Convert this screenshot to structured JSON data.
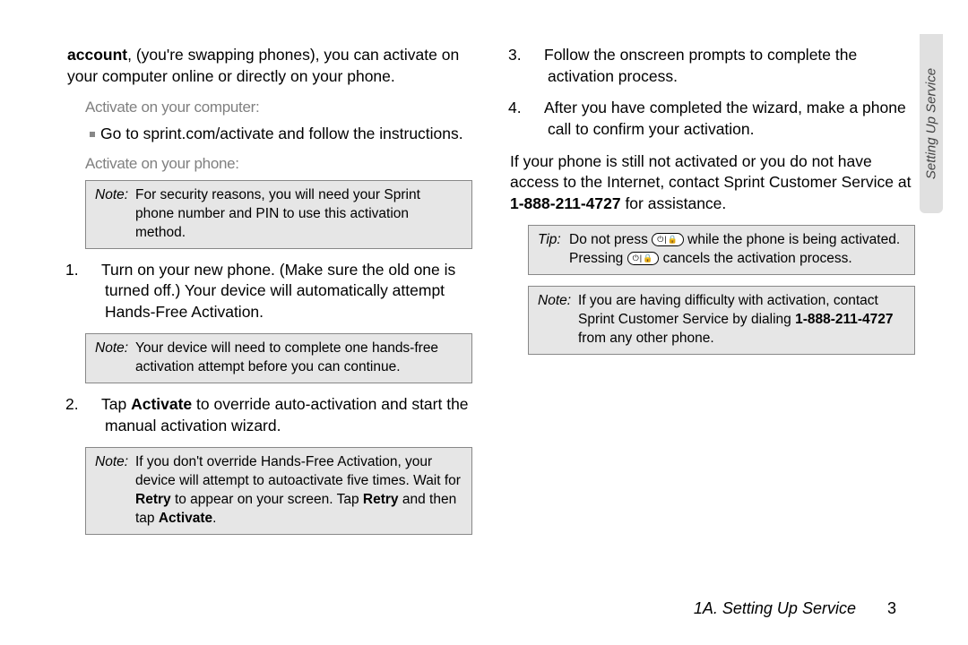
{
  "col1": {
    "intro_lead_bold": "account",
    "intro_rest": ", (you're swapping phones), you can activate on your computer online or directly on your phone.",
    "subhead1": "Activate on your computer:",
    "bullet1": "Go to sprint.com/activate and follow the instructions.",
    "subhead2": "Activate on your phone:",
    "note1_label": "Note:",
    "note1_body": "For security reasons, you will need your Sprint phone number and PIN to use this activation method.",
    "step1_num": "1.",
    "step1": "Turn on your new phone. (Make sure the old one is turned off.) Your device will automatically attempt Hands-Free Activation.",
    "note2_label": "Note:",
    "note2_body": "Your device will need to complete one hands-free activation attempt before you can continue.",
    "step2_num": "2.",
    "step2_a": "Tap ",
    "step2_b_bold": "Activate",
    "step2_c": " to override auto-activation and start the manual activation wizard.",
    "note3_label": "Note:",
    "note3_a": "If you don't override Hands-Free Activation, your device will attempt to autoactivate five times. Wait for ",
    "note3_b_bold": "Retry",
    "note3_c": " to appear on your screen. Tap ",
    "note3_d_bold": "Retry",
    "note3_e": " and then tap ",
    "note3_f_bold": "Activate",
    "note3_g": "."
  },
  "col2": {
    "step3_num": "3.",
    "step3": "Follow the onscreen prompts to complete the activation process.",
    "step4_num": "4.",
    "step4": "After you have completed the wizard, make a phone call to confirm your activation.",
    "para_a": "If your phone is still not activated or you do not have access to the Internet, contact Sprint Customer Service at ",
    "para_b_bold": "1-888-211-4727",
    "para_c": " for assistance.",
    "tip_label": "Tip:",
    "tip_a": "Do not press ",
    "tip_b": " while the phone is being activated. Pressing ",
    "tip_c": " cancels the activation process.",
    "note4_label": "Note:",
    "note4_a": "If you are having difficulty with activation, contact Sprint Customer Service by dialing ",
    "note4_b_bold": "1-888-211-4727",
    "note4_c": " from any other phone."
  },
  "sidetab": "Setting Up Service",
  "footer_section": "1A. Setting Up Service",
  "footer_page": "3"
}
